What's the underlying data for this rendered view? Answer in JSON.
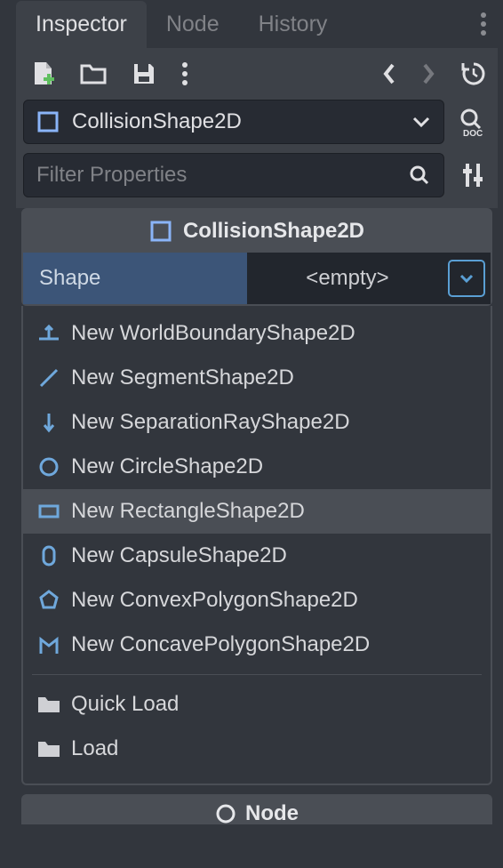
{
  "tabs": {
    "inspector": "Inspector",
    "node": "Node",
    "history": "History"
  },
  "node_selector": {
    "name": "CollisionShape2D"
  },
  "filter": {
    "placeholder": "Filter Properties"
  },
  "section": {
    "title": "CollisionShape2D"
  },
  "property": {
    "label": "Shape",
    "value": "<empty>"
  },
  "dropdown": {
    "items": [
      {
        "label": "New WorldBoundaryShape2D",
        "icon": "world-boundary",
        "hover": false
      },
      {
        "label": "New SegmentShape2D",
        "icon": "segment",
        "hover": false
      },
      {
        "label": "New SeparationRayShape2D",
        "icon": "separation-ray",
        "hover": false
      },
      {
        "label": "New CircleShape2D",
        "icon": "circle",
        "hover": false
      },
      {
        "label": "New RectangleShape2D",
        "icon": "rectangle",
        "hover": true
      },
      {
        "label": "New CapsuleShape2D",
        "icon": "capsule",
        "hover": false
      },
      {
        "label": "New ConvexPolygonShape2D",
        "icon": "convex",
        "hover": false
      },
      {
        "label": "New ConcavePolygonShape2D",
        "icon": "concave",
        "hover": false
      }
    ],
    "quick_load": "Quick Load",
    "load": "Load"
  },
  "bottom_section": {
    "title": "Node"
  },
  "colors": {
    "accent": "#5a9fd4",
    "icon_blue": "#6fa8dc"
  }
}
